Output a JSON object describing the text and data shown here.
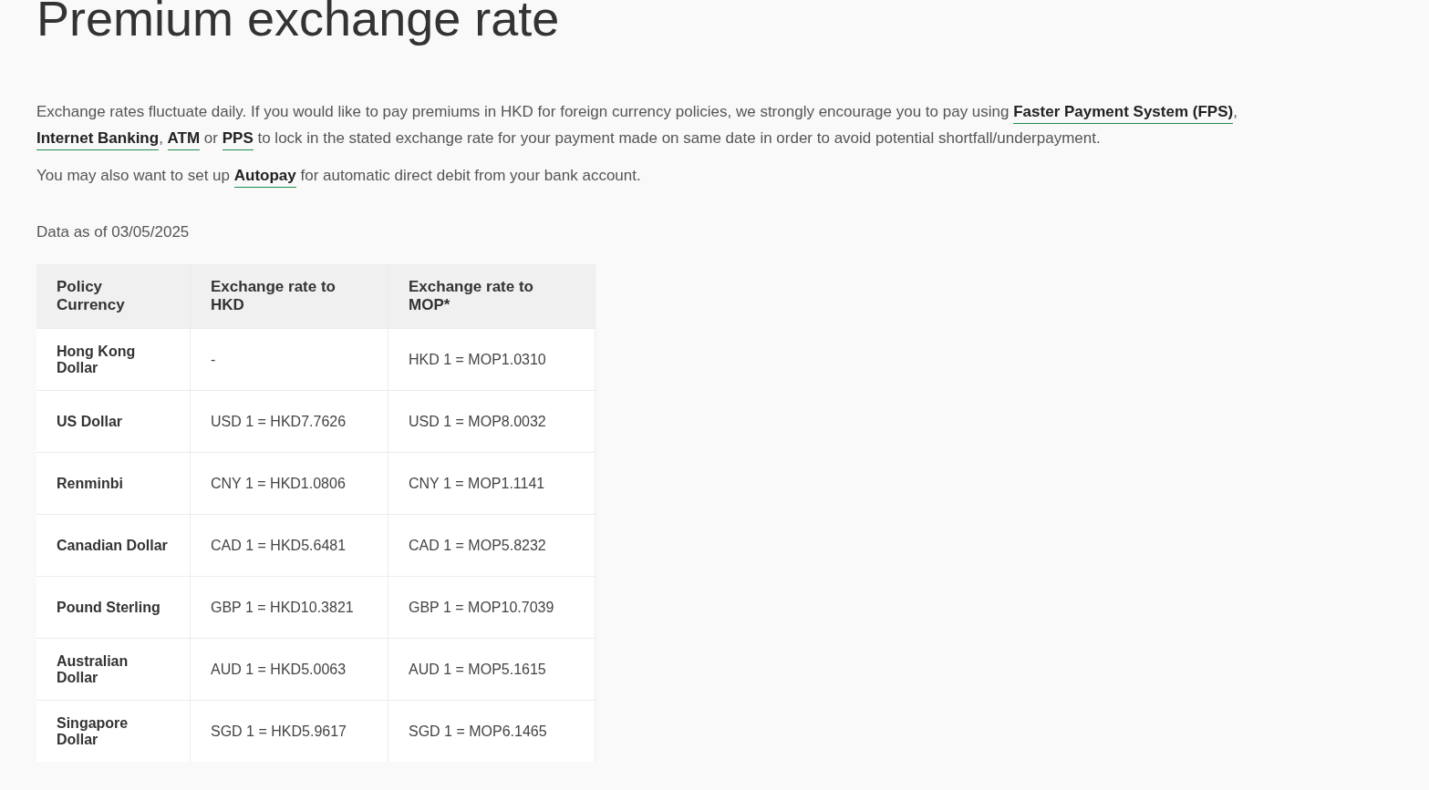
{
  "title": "Premium exchange rate",
  "paragraphs": [
    [
      {
        "kind": "text",
        "text": "Exchange rates fluctuate daily. If you would like to pay premiums in HKD for foreign currency policies, we strongly encourage you to pay using "
      },
      {
        "kind": "link",
        "text": "Faster Payment System (FPS)"
      },
      {
        "kind": "text",
        "text": ", "
      },
      {
        "kind": "link",
        "text": "Internet Banking"
      },
      {
        "kind": "text",
        "text": ", "
      },
      {
        "kind": "link",
        "text": "ATM"
      },
      {
        "kind": "text",
        "text": " or "
      },
      {
        "kind": "link",
        "text": "PPS"
      },
      {
        "kind": "text",
        "text": " to lock in the stated exchange rate for your payment made on same date in order to avoid potential shortfall/underpayment."
      }
    ],
    [
      {
        "kind": "text",
        "text": "You may also want to set up "
      },
      {
        "kind": "link",
        "text": "Autopay"
      },
      {
        "kind": "text",
        "text": " for automatic direct debit from your bank account."
      }
    ]
  ],
  "data_date": "Data as of 03/05/2025",
  "table": {
    "columns": [
      "Policy Currency",
      "Exchange rate to HKD",
      "Exchange rate to MOP*"
    ],
    "rows": [
      [
        "Hong Kong Dollar",
        "-",
        "HKD 1 = MOP1.0310"
      ],
      [
        "US Dollar",
        "USD 1 = HKD7.7626",
        "USD 1 = MOP8.0032"
      ],
      [
        "Renminbi",
        "CNY 1 = HKD1.0806",
        "CNY 1 = MOP1.1141"
      ],
      [
        "Canadian Dollar",
        "CAD 1 = HKD5.6481",
        "CAD 1 = MOP5.8232"
      ],
      [
        "Pound Sterling",
        "GBP 1 = HKD10.3821",
        "GBP 1 = MOP10.7039"
      ],
      [
        "Australian Dollar",
        "AUD 1 = HKD5.0063",
        "AUD 1 = MOP5.1615"
      ],
      [
        "Singapore Dollar",
        "SGD 1 = HKD5.9617",
        "SGD 1 = MOP6.1465"
      ]
    ]
  }
}
